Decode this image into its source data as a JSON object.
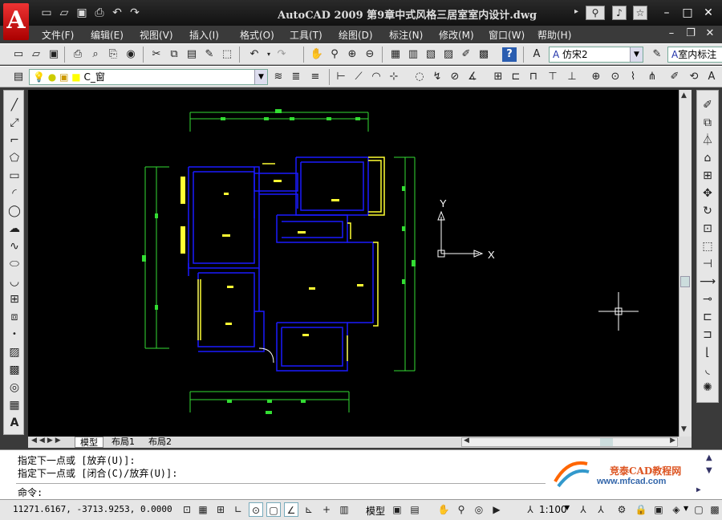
{
  "app": {
    "title": "AutoCAD  2009  第9章中式风格三居室室内设计.dwg",
    "logo_letter": "A"
  },
  "title_icons": [
    "new-icon",
    "open-icon",
    "save-icon",
    "print-icon",
    "undo-icon",
    "redo-icon"
  ],
  "window_controls": {
    "minimize": "–",
    "restore": "□",
    "close": "✕"
  },
  "menu": [
    "文件(F)",
    "编辑(E)",
    "视图(V)",
    "插入(I)",
    "格式(O)",
    "工具(T)",
    "绘图(D)",
    "标注(N)",
    "修改(M)",
    "窗口(W)",
    "帮助(H)"
  ],
  "toolbar": {
    "text_style": "仿宋2",
    "dim_style": "室内标注",
    "layer": "C_窗"
  },
  "tabs": {
    "model": "模型",
    "layout1": "布局1",
    "layout2": "布局2"
  },
  "command": {
    "history": [
      "指定下一点或 [放弃(U)]:",
      "指定下一点或 [闭合(C)/放弃(U)]:"
    ],
    "prompt": "命令:"
  },
  "watermark": {
    "brand": "竞泰CAD教程网",
    "url": "www.mfcad.com"
  },
  "status": {
    "coordinates": "11271.6167, -3713.9253, 0.0000",
    "model_label": "模型",
    "scale": "1:100"
  },
  "ucs": {
    "x_label": "X",
    "y_label": "Y"
  },
  "colors": {
    "wall": "#1a1aff",
    "window": "#ffff33",
    "dimension": "#33dd33",
    "background": "#000000"
  }
}
